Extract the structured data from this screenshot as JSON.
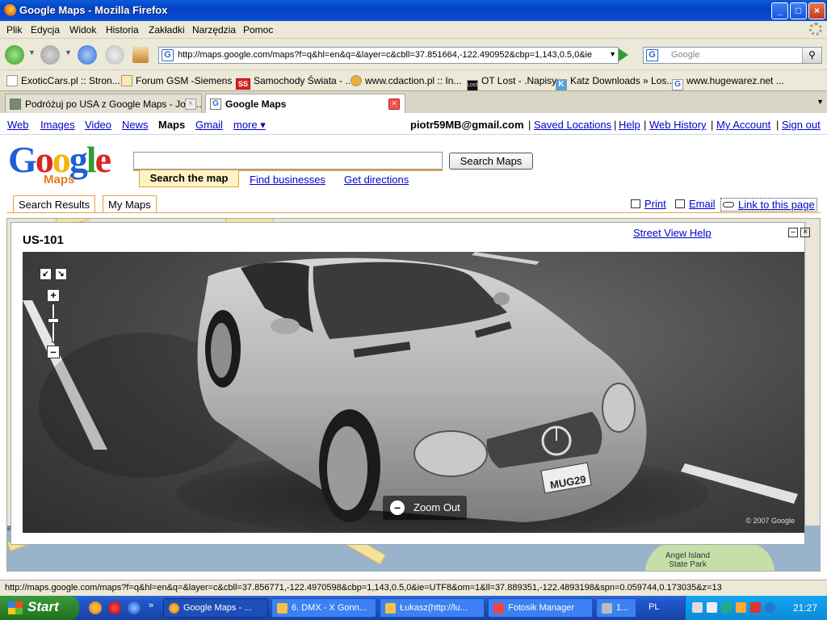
{
  "window": {
    "title": "Google Maps - Mozilla Firefox"
  },
  "menu": [
    "Plik",
    "Edycja",
    "Widok",
    "Historia",
    "Zakładki",
    "Narzędzia",
    "Pomoc"
  ],
  "nav": {
    "url": "http://maps.google.com/maps?f=q&hl=en&q=&layer=c&cbll=37.851664,-122.490952&cbp=1,143,0.5,0&ie",
    "search_placeholder": "Google"
  },
  "bookmarks": [
    "ExoticCars.pl :: Stron...",
    "Forum GSM -Siemens ...",
    "Samochody Świata - ...",
    "www.cdaction.pl :: In...",
    "OT Lost - .Napisy",
    "Katz Downloads » Los...",
    "www.hugewarez.net ..."
  ],
  "bookmark_badges": {
    "ss": "SS",
    "lost": "LOST",
    "katz": "K",
    "g": "G"
  },
  "tabs": [
    {
      "label": "Podróżuj po USA z Google Maps - Joe ...",
      "close": "×"
    },
    {
      "label": "Google Maps",
      "close": "×"
    }
  ],
  "gbar": {
    "links": [
      "Web",
      "Images",
      "Video",
      "News",
      "Maps",
      "Gmail",
      "more ▾"
    ],
    "user": "piotr59MB@gmail.com",
    "right_links": [
      "Saved Locations",
      "Help",
      "Web History",
      "My Account",
      "Sign out"
    ],
    "sep": "|"
  },
  "search": {
    "logo_letters": [
      "G",
      "o",
      "o",
      "g",
      "l",
      "e"
    ],
    "logo_colors": [
      "#1f5ed6",
      "#d8261d",
      "#f1b50a",
      "#1f5ed6",
      "#2f9d2f",
      "#d8261d"
    ],
    "logo_sub": "Maps",
    "button": "Search Maps",
    "tab_active": "Search the map",
    "tab_find": "Find businesses",
    "tab_directions": "Get directions"
  },
  "panel_tabs": [
    "Search Results",
    "My Maps"
  ],
  "actions": {
    "print": "Print",
    "email": "Email",
    "link": "Link to this page"
  },
  "map": {
    "label_line1": "Angel Island",
    "label_line2": "State Park",
    "label_left": "eac"
  },
  "streetview": {
    "title": "US-101",
    "help": "Street View Help",
    "minimize": "–",
    "close": "×",
    "zoom_out": "Zoom Out",
    "zoom_out_sign": "–",
    "copyright": "© 2007 Google",
    "plate": "MUG29",
    "controls": {
      "expand1": "↙",
      "expand2": "↘",
      "plus": "+",
      "minus": "–"
    }
  },
  "status": "http://maps.google.com/maps?f=q&hl=en&q=&layer=c&cbll=37.856771,-122.4970598&cbp=1,143,0.5,0&ie=UTF8&om=1&ll=37.889351,-122.4893198&spn=0.059744,0.173035&z=13",
  "taskbar": {
    "start": "Start",
    "more": "»",
    "items": [
      "Google Maps - ...",
      "6. DMX - X Gonn...",
      "Łukasz(http://lu...",
      "Fotosik Manager",
      "1..."
    ],
    "lang": "PL",
    "clock": "21:27"
  }
}
